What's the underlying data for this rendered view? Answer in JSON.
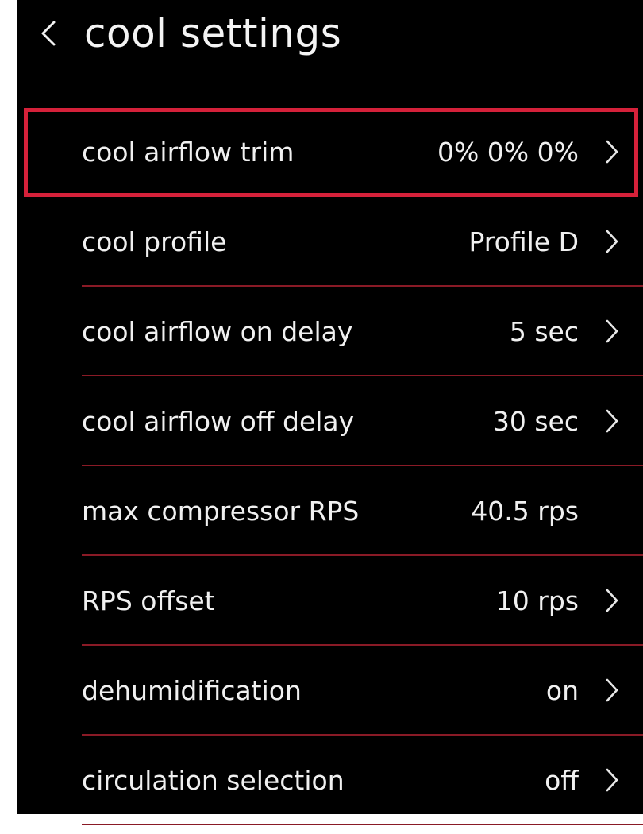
{
  "header": {
    "title": "cool settings",
    "back_icon": "chevron-left-icon"
  },
  "colors": {
    "background": "#000000",
    "text": "#f0f0f0",
    "divider": "#8a1a26",
    "highlight": "#d5213a"
  },
  "settings": [
    {
      "label": "cool airflow trim",
      "value": "0% 0% 0%",
      "has_chevron": true,
      "selected": true
    },
    {
      "label": "cool profile",
      "value": "Profile D",
      "has_chevron": true
    },
    {
      "label": "cool airflow on delay",
      "value": "5 sec",
      "has_chevron": true
    },
    {
      "label": "cool airflow off delay",
      "value": "30 sec",
      "has_chevron": true
    },
    {
      "label": "max compressor RPS",
      "value": "40.5 rps",
      "has_chevron": false
    },
    {
      "label": "RPS offset",
      "value": "10 rps",
      "has_chevron": true
    },
    {
      "label": "dehumidification",
      "value": "on",
      "has_chevron": true
    },
    {
      "label": "circulation selection",
      "value": "off",
      "has_chevron": true
    }
  ]
}
